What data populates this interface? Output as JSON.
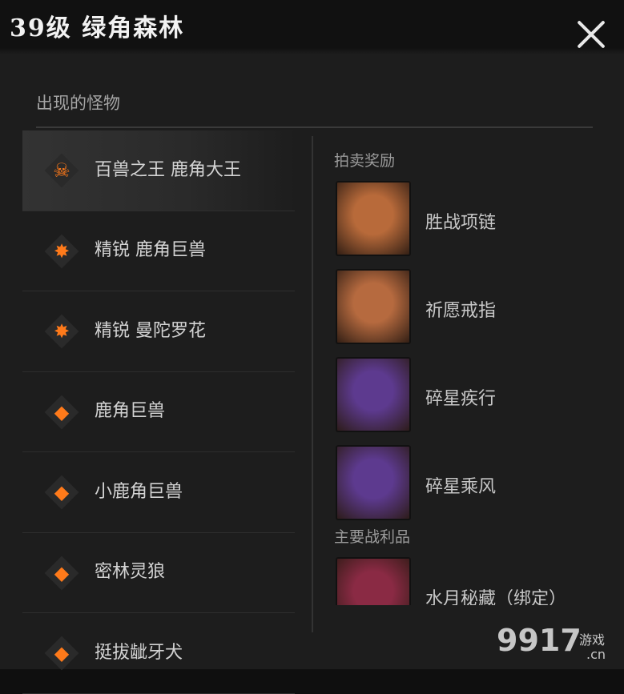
{
  "header": {
    "title": "39级 绿角森林"
  },
  "left": {
    "section_title": "出现的怪物",
    "monsters": [
      {
        "name": "百兽之王 鹿角大王",
        "icon": "boss-skull-icon",
        "glyph": "☠",
        "selected": true
      },
      {
        "name": "精锐 鹿角巨兽",
        "icon": "elite-burst-icon",
        "glyph": "✸"
      },
      {
        "name": "精锐 曼陀罗花",
        "icon": "elite-burst-icon",
        "glyph": "✸"
      },
      {
        "name": "鹿角巨兽",
        "icon": "normal-diamond-icon",
        "glyph": "◆"
      },
      {
        "name": "小鹿角巨兽",
        "icon": "normal-diamond-icon",
        "glyph": "◆"
      },
      {
        "name": "密林灵狼",
        "icon": "normal-diamond-icon",
        "glyph": "◆"
      },
      {
        "name": "挺拔龇牙犬",
        "icon": "normal-diamond-icon",
        "glyph": "◆"
      }
    ]
  },
  "right": {
    "auction_title": "拍卖奖励",
    "auction_items": [
      {
        "name": "胜战项链",
        "icon": "necklace-icon",
        "color": "#b86a3a"
      },
      {
        "name": "祈愿戒指",
        "icon": "ring-icon",
        "color": "#b66a3f"
      },
      {
        "name": "碎星疾行",
        "icon": "starfall-dash-icon",
        "color": "#5d3a8f"
      },
      {
        "name": "碎星乘风",
        "icon": "starfall-wind-icon",
        "color": "#5d3a8f"
      }
    ],
    "loot_title": "主要战利品",
    "loot_items": [
      {
        "name": "水月秘藏（绑定）",
        "icon": "treasure-chest-icon",
        "color": "#8a2a44"
      }
    ]
  },
  "watermark": {
    "number": "9917",
    "text1": "游戏",
    "text2": ".cn"
  }
}
